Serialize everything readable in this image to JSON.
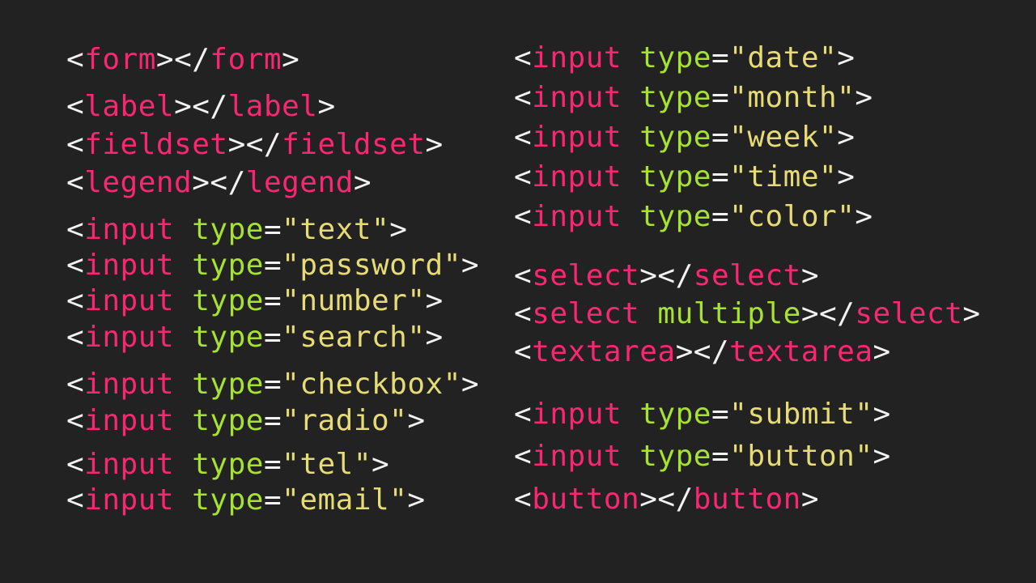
{
  "colors": {
    "background": "#222222",
    "bracket": "#f2f2f2",
    "tag": "#f92672",
    "attribute": "#a6e22e",
    "string": "#e6db74"
  },
  "left_column": [
    [
      {
        "t": "<",
        "c": "bracket"
      },
      {
        "t": "form",
        "c": "tag"
      },
      {
        "t": "></",
        "c": "bracket"
      },
      {
        "t": "form",
        "c": "tag"
      },
      {
        "t": ">",
        "c": "bracket"
      }
    ],
    [
      {
        "t": "<",
        "c": "bracket"
      },
      {
        "t": "label",
        "c": "tag"
      },
      {
        "t": "></",
        "c": "bracket"
      },
      {
        "t": "label",
        "c": "tag"
      },
      {
        "t": ">",
        "c": "bracket"
      }
    ],
    [
      {
        "t": "<",
        "c": "bracket"
      },
      {
        "t": "fieldset",
        "c": "tag"
      },
      {
        "t": "></",
        "c": "bracket"
      },
      {
        "t": "fieldset",
        "c": "tag"
      },
      {
        "t": ">",
        "c": "bracket"
      }
    ],
    [
      {
        "t": "<",
        "c": "bracket"
      },
      {
        "t": "legend",
        "c": "tag"
      },
      {
        "t": "></",
        "c": "bracket"
      },
      {
        "t": "legend",
        "c": "tag"
      },
      {
        "t": ">",
        "c": "bracket"
      }
    ],
    [
      {
        "t": "<",
        "c": "bracket"
      },
      {
        "t": "input",
        "c": "tag"
      },
      {
        "t": " ",
        "c": "bracket"
      },
      {
        "t": "type",
        "c": "attr"
      },
      {
        "t": "=",
        "c": "eq"
      },
      {
        "t": "\"text\"",
        "c": "str"
      },
      {
        "t": ">",
        "c": "bracket"
      }
    ],
    [
      {
        "t": "<",
        "c": "bracket"
      },
      {
        "t": "input",
        "c": "tag"
      },
      {
        "t": " ",
        "c": "bracket"
      },
      {
        "t": "type",
        "c": "attr"
      },
      {
        "t": "=",
        "c": "eq"
      },
      {
        "t": "\"password\"",
        "c": "str"
      },
      {
        "t": ">",
        "c": "bracket"
      }
    ],
    [
      {
        "t": "<",
        "c": "bracket"
      },
      {
        "t": "input",
        "c": "tag"
      },
      {
        "t": " ",
        "c": "bracket"
      },
      {
        "t": "type",
        "c": "attr"
      },
      {
        "t": "=",
        "c": "eq"
      },
      {
        "t": "\"number\"",
        "c": "str"
      },
      {
        "t": ">",
        "c": "bracket"
      }
    ],
    [
      {
        "t": "<",
        "c": "bracket"
      },
      {
        "t": "input",
        "c": "tag"
      },
      {
        "t": " ",
        "c": "bracket"
      },
      {
        "t": "type",
        "c": "attr"
      },
      {
        "t": "=",
        "c": "eq"
      },
      {
        "t": "\"search\"",
        "c": "str"
      },
      {
        "t": ">",
        "c": "bracket"
      }
    ],
    [
      {
        "t": "<",
        "c": "bracket"
      },
      {
        "t": "input",
        "c": "tag"
      },
      {
        "t": " ",
        "c": "bracket"
      },
      {
        "t": "type",
        "c": "attr"
      },
      {
        "t": "=",
        "c": "eq"
      },
      {
        "t": "\"checkbox\"",
        "c": "str"
      },
      {
        "t": ">",
        "c": "bracket"
      }
    ],
    [
      {
        "t": "<",
        "c": "bracket"
      },
      {
        "t": "input",
        "c": "tag"
      },
      {
        "t": " ",
        "c": "bracket"
      },
      {
        "t": "type",
        "c": "attr"
      },
      {
        "t": "=",
        "c": "eq"
      },
      {
        "t": "\"radio\"",
        "c": "str"
      },
      {
        "t": ">",
        "c": "bracket"
      }
    ],
    [
      {
        "t": "<",
        "c": "bracket"
      },
      {
        "t": "input",
        "c": "tag"
      },
      {
        "t": " ",
        "c": "bracket"
      },
      {
        "t": "type",
        "c": "attr"
      },
      {
        "t": "=",
        "c": "eq"
      },
      {
        "t": "\"tel\"",
        "c": "str"
      },
      {
        "t": ">",
        "c": "bracket"
      }
    ],
    [
      {
        "t": "<",
        "c": "bracket"
      },
      {
        "t": "input",
        "c": "tag"
      },
      {
        "t": " ",
        "c": "bracket"
      },
      {
        "t": "type",
        "c": "attr"
      },
      {
        "t": "=",
        "c": "eq"
      },
      {
        "t": "\"email\"",
        "c": "str"
      },
      {
        "t": ">",
        "c": "bracket"
      }
    ]
  ],
  "right_column": [
    [
      {
        "t": "<",
        "c": "bracket"
      },
      {
        "t": "input",
        "c": "tag"
      },
      {
        "t": " ",
        "c": "bracket"
      },
      {
        "t": "type",
        "c": "attr"
      },
      {
        "t": "=",
        "c": "eq"
      },
      {
        "t": "\"date\"",
        "c": "str"
      },
      {
        "t": ">",
        "c": "bracket"
      }
    ],
    [
      {
        "t": "<",
        "c": "bracket"
      },
      {
        "t": "input",
        "c": "tag"
      },
      {
        "t": " ",
        "c": "bracket"
      },
      {
        "t": "type",
        "c": "attr"
      },
      {
        "t": "=",
        "c": "eq"
      },
      {
        "t": "\"month\"",
        "c": "str"
      },
      {
        "t": ">",
        "c": "bracket"
      }
    ],
    [
      {
        "t": "<",
        "c": "bracket"
      },
      {
        "t": "input",
        "c": "tag"
      },
      {
        "t": " ",
        "c": "bracket"
      },
      {
        "t": "type",
        "c": "attr"
      },
      {
        "t": "=",
        "c": "eq"
      },
      {
        "t": "\"week\"",
        "c": "str"
      },
      {
        "t": ">",
        "c": "bracket"
      }
    ],
    [
      {
        "t": "<",
        "c": "bracket"
      },
      {
        "t": "input",
        "c": "tag"
      },
      {
        "t": " ",
        "c": "bracket"
      },
      {
        "t": "type",
        "c": "attr"
      },
      {
        "t": "=",
        "c": "eq"
      },
      {
        "t": "\"time\"",
        "c": "str"
      },
      {
        "t": ">",
        "c": "bracket"
      }
    ],
    [
      {
        "t": "<",
        "c": "bracket"
      },
      {
        "t": "input",
        "c": "tag"
      },
      {
        "t": " ",
        "c": "bracket"
      },
      {
        "t": "type",
        "c": "attr"
      },
      {
        "t": "=",
        "c": "eq"
      },
      {
        "t": "\"color\"",
        "c": "str"
      },
      {
        "t": ">",
        "c": "bracket"
      }
    ],
    [
      {
        "t": "<",
        "c": "bracket"
      },
      {
        "t": "select",
        "c": "tag"
      },
      {
        "t": "></",
        "c": "bracket"
      },
      {
        "t": "select",
        "c": "tag"
      },
      {
        "t": ">",
        "c": "bracket"
      }
    ],
    [
      {
        "t": "<",
        "c": "bracket"
      },
      {
        "t": "select",
        "c": "tag"
      },
      {
        "t": " ",
        "c": "bracket"
      },
      {
        "t": "multiple",
        "c": "attr"
      },
      {
        "t": "></",
        "c": "bracket"
      },
      {
        "t": "select",
        "c": "tag"
      },
      {
        "t": ">",
        "c": "bracket"
      }
    ],
    [
      {
        "t": "<",
        "c": "bracket"
      },
      {
        "t": "textarea",
        "c": "tag"
      },
      {
        "t": "></",
        "c": "bracket"
      },
      {
        "t": "textarea",
        "c": "tag"
      },
      {
        "t": ">",
        "c": "bracket"
      }
    ],
    [
      {
        "t": "<",
        "c": "bracket"
      },
      {
        "t": "input",
        "c": "tag"
      },
      {
        "t": " ",
        "c": "bracket"
      },
      {
        "t": "type",
        "c": "attr"
      },
      {
        "t": "=",
        "c": "eq"
      },
      {
        "t": "\"submit\"",
        "c": "str"
      },
      {
        "t": ">",
        "c": "bracket"
      }
    ],
    [
      {
        "t": "<",
        "c": "bracket"
      },
      {
        "t": "input",
        "c": "tag"
      },
      {
        "t": " ",
        "c": "bracket"
      },
      {
        "t": "type",
        "c": "attr"
      },
      {
        "t": "=",
        "c": "eq"
      },
      {
        "t": "\"button\"",
        "c": "str"
      },
      {
        "t": ">",
        "c": "bracket"
      }
    ],
    [
      {
        "t": "<",
        "c": "bracket"
      },
      {
        "t": "button",
        "c": "tag"
      },
      {
        "t": "></",
        "c": "bracket"
      },
      {
        "t": "button",
        "c": "tag"
      },
      {
        "t": ">",
        "c": "bracket"
      }
    ]
  ]
}
